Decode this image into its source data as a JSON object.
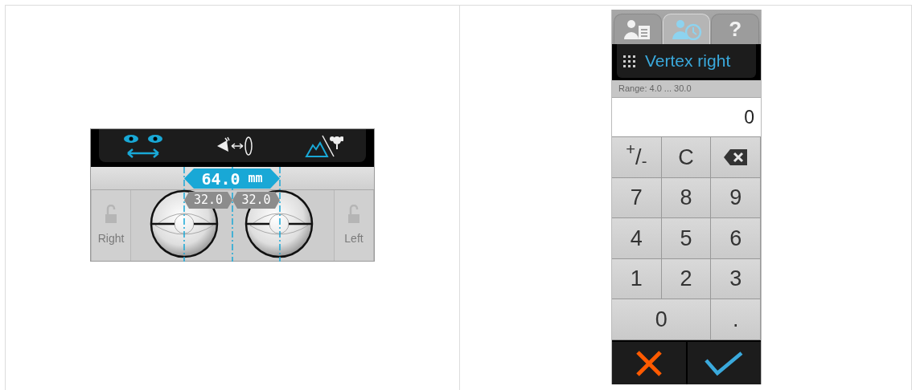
{
  "pd_panel": {
    "total_value": "64.0",
    "total_unit": "mm",
    "right_value": "32.0",
    "left_value": "32.0",
    "locks": [
      {
        "label": "Right",
        "locked": false
      },
      {
        "label": "Left",
        "locked": false
      }
    ]
  },
  "keypad_panel": {
    "tabs": [
      {
        "kind": "patient-record",
        "selected": false
      },
      {
        "kind": "patient-history",
        "selected": true
      },
      {
        "kind": "help",
        "label": "?",
        "selected": false
      }
    ],
    "title": "Vertex right",
    "range": "Range: 4.0 ... 30.0",
    "value": "0",
    "keys": [
      {
        "kind": "text",
        "label": "$^{+}$/$_{-}$"
      },
      {
        "kind": "text",
        "label": "C"
      },
      {
        "kind": "backspace"
      },
      {
        "kind": "text",
        "label": "7"
      },
      {
        "kind": "text",
        "label": "8"
      },
      {
        "kind": "text",
        "label": "9"
      },
      {
        "kind": "text",
        "label": "4"
      },
      {
        "kind": "text",
        "label": "5"
      },
      {
        "kind": "text",
        "label": "6"
      },
      {
        "kind": "text",
        "label": "1"
      },
      {
        "kind": "text",
        "label": "2"
      },
      {
        "kind": "text",
        "label": "3"
      },
      {
        "kind": "wide",
        "label": "0"
      },
      {
        "kind": "text",
        "label": "."
      }
    ]
  }
}
